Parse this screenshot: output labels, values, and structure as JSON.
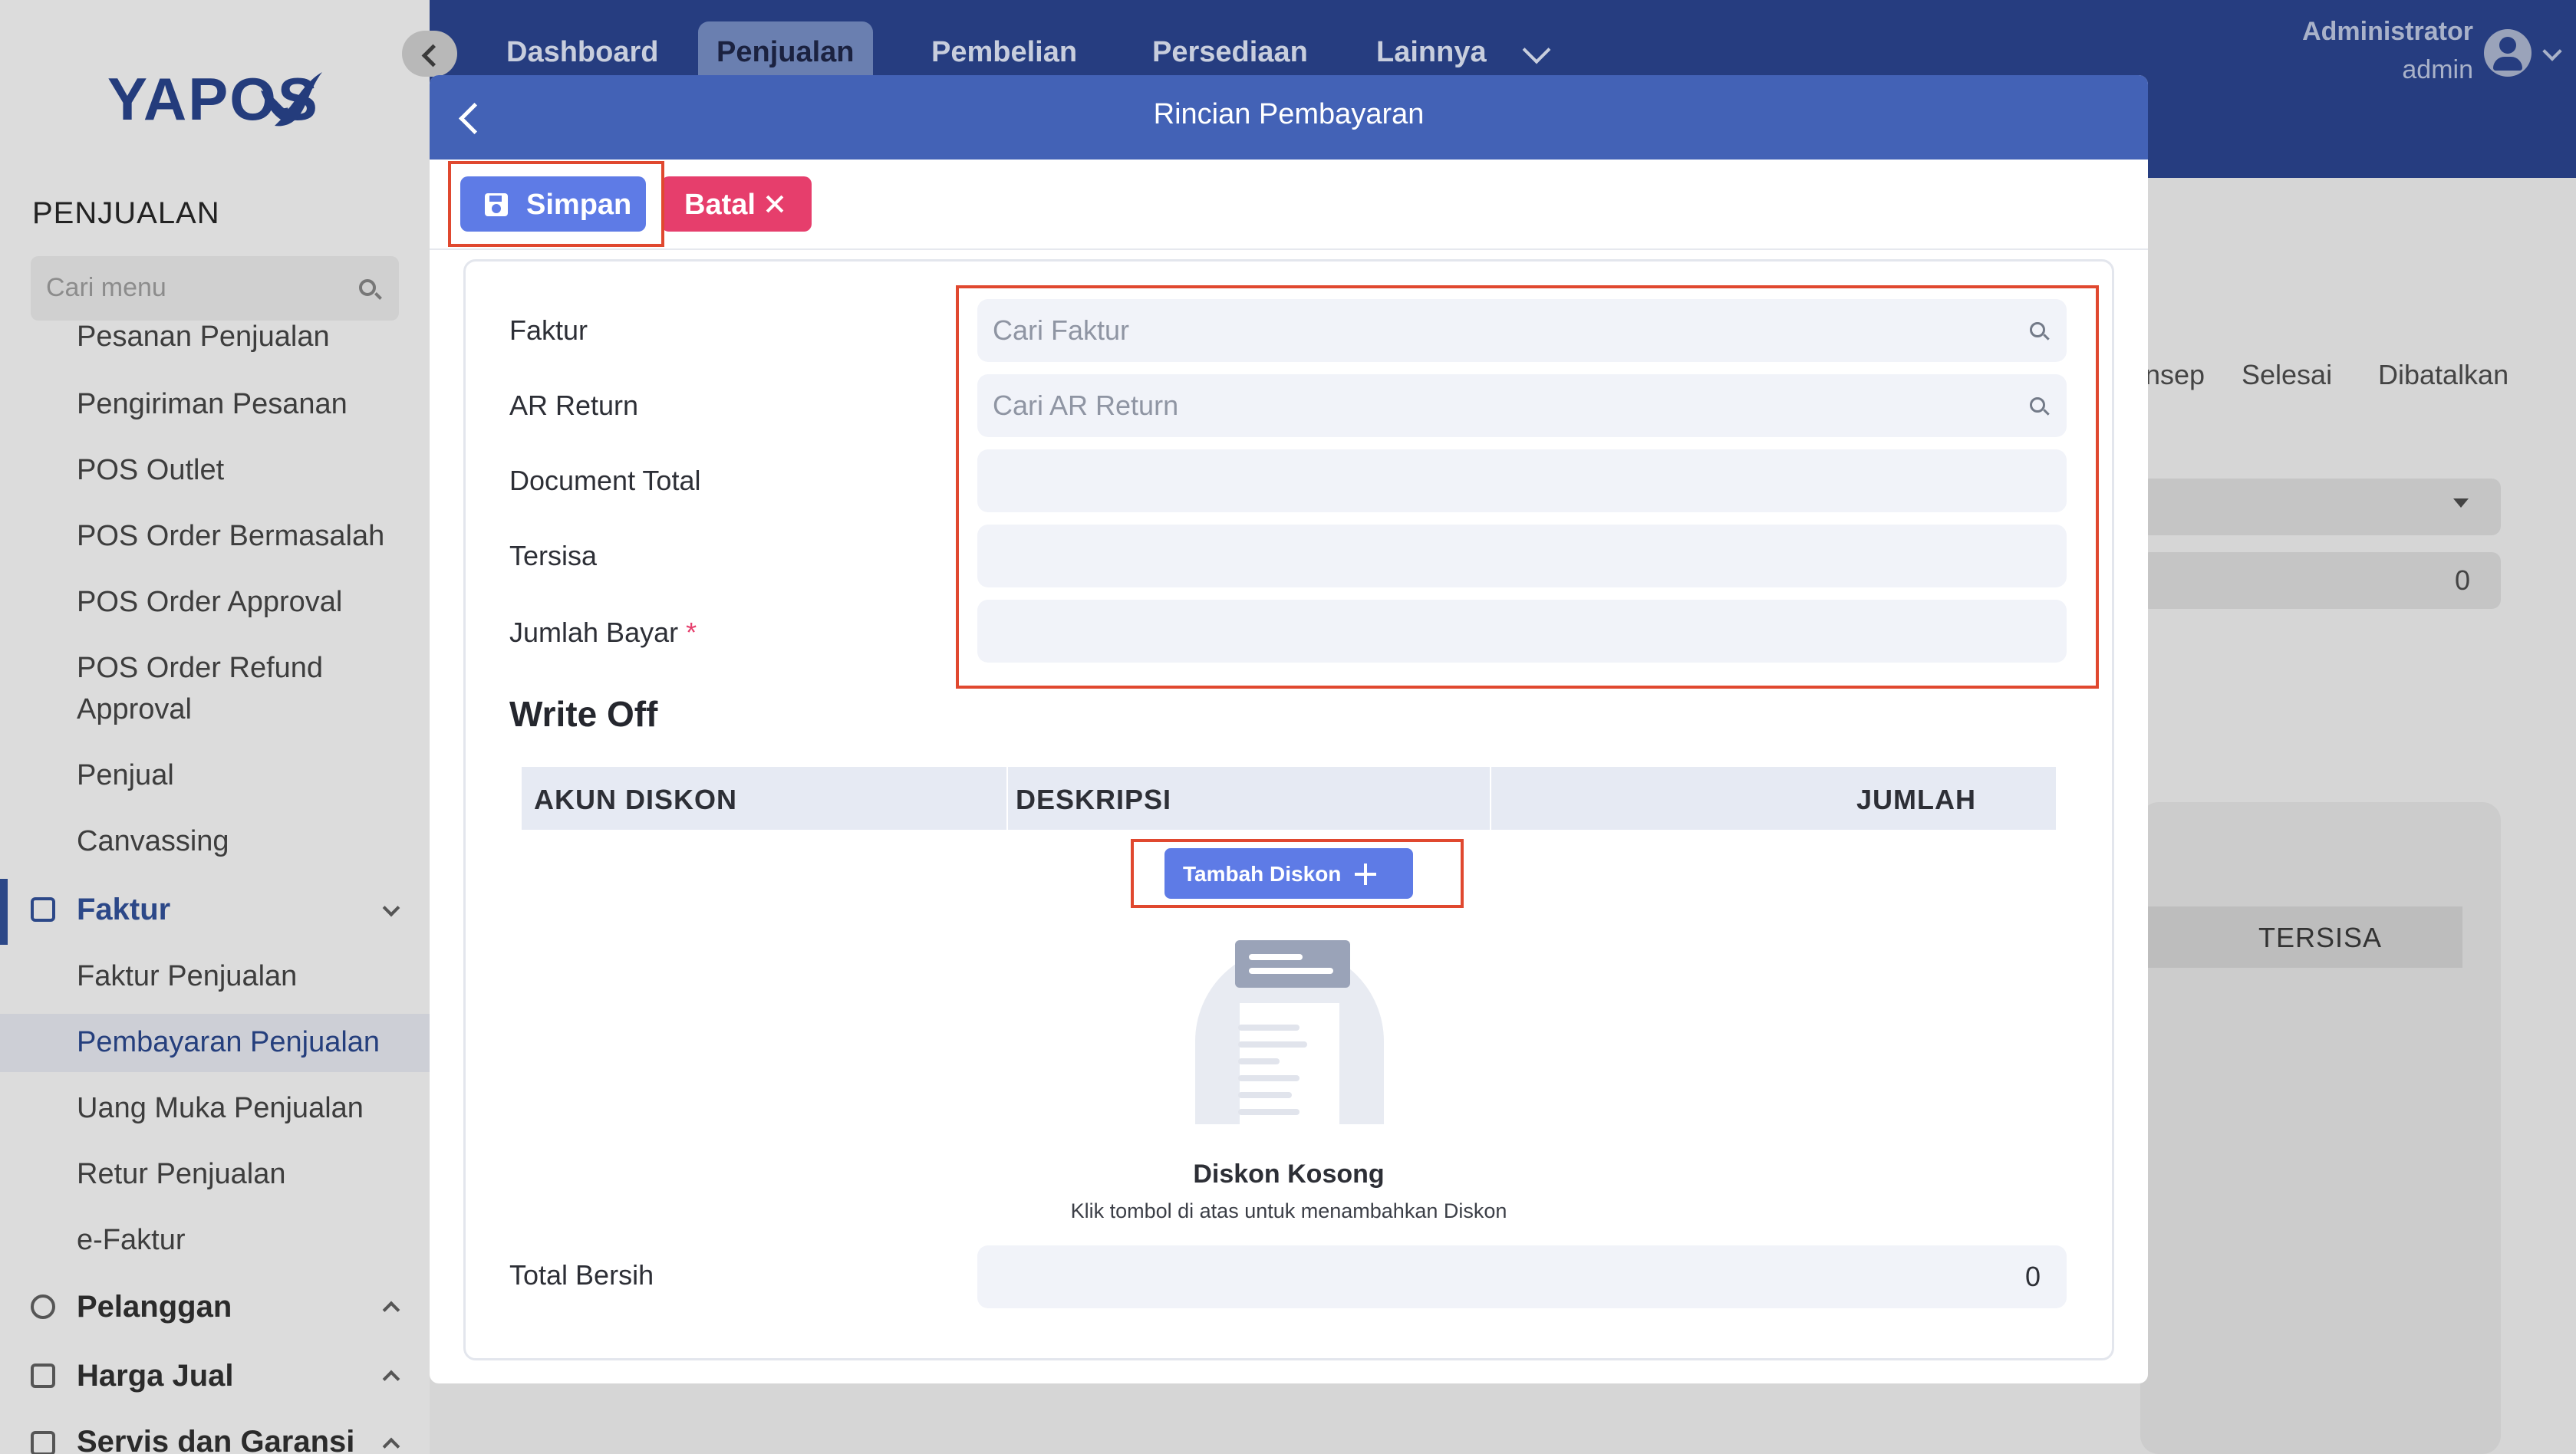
{
  "app": {
    "logo_text": "YAPOS"
  },
  "topnav": {
    "items": [
      {
        "label": "Dashboard"
      },
      {
        "label": "Penjualan"
      },
      {
        "label": "Pembelian"
      },
      {
        "label": "Persediaan"
      },
      {
        "label": "Lainnya"
      }
    ],
    "active": "Penjualan"
  },
  "user": {
    "name": "Administrator",
    "role": "admin"
  },
  "sidebar": {
    "section_title": "PENJUALAN",
    "search_placeholder": "Cari menu",
    "items": [
      {
        "label": "Pesanan Penjualan"
      },
      {
        "label": "Pengiriman Pesanan"
      },
      {
        "label": "POS Outlet"
      },
      {
        "label": "POS Order Bermasalah"
      },
      {
        "label": "POS Order Approval"
      },
      {
        "label": "POS Order Refund"
      },
      {
        "label": "Approval"
      },
      {
        "label": "Penjual"
      },
      {
        "label": "Canvassing"
      }
    ],
    "groups": [
      {
        "label": "Faktur"
      },
      {
        "label": "Pelanggan"
      },
      {
        "label": "Harga Jual"
      },
      {
        "label": "Servis dan Garansi"
      }
    ],
    "faktur_items": [
      {
        "label": "Faktur Penjualan"
      },
      {
        "label": "Pembayaran Penjualan"
      },
      {
        "label": "Uang Muka Penjualan"
      },
      {
        "label": "Retur Penjualan"
      },
      {
        "label": "e-Faktur"
      }
    ]
  },
  "background": {
    "steps": [
      "nsep",
      "Selesai",
      "Dibatalkan"
    ],
    "zero_value": "0",
    "table_header": "TERSISA"
  },
  "modal": {
    "title": "Rincian Pembayaran",
    "save_label": "Simpan",
    "cancel_label": "Batal",
    "fields": {
      "faktur": {
        "label": "Faktur",
        "placeholder": "Cari Faktur",
        "value": ""
      },
      "ar_return": {
        "label": "AR Return",
        "placeholder": "Cari AR Return",
        "value": ""
      },
      "document_total": {
        "label": "Document Total",
        "value": ""
      },
      "tersisa": {
        "label": "Tersisa",
        "value": ""
      },
      "jumlah_bayar": {
        "label": "Jumlah Bayar",
        "required_mark": "*",
        "value": ""
      }
    },
    "write_off": {
      "title": "Write Off",
      "columns": [
        "AKUN DISKON",
        "DESKRIPSI",
        "JUMLAH"
      ],
      "add_button_label": "Tambah Diskon",
      "empty_title": "Diskon Kosong",
      "empty_desc": "Klik tombol di atas untuk menambahkan Diskon"
    },
    "total_bersih": {
      "label": "Total Bersih",
      "value": "0"
    }
  },
  "colors": {
    "header_blue": "#4362b6",
    "primary_button": "#5e7be6",
    "cancel_button": "#e63e6c",
    "highlight_red": "#e0482f",
    "topbar_navy": "#263d80"
  }
}
